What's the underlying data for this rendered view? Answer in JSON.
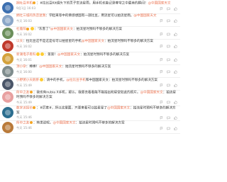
{
  "comments": [
    {
      "user": "拥吐豆羊机",
      "verified": true,
      "emojis": 0,
      "text_before_mention": "：#拉比豆Kit镜头下的页子世流星雨，用手机也能记录尊穹之中最美的瞬间！",
      "mention": "@中国国家天文",
      "text_after_mention": "",
      "time": "9月1日 16:03",
      "avatar_color": "#3c6fb0"
    },
    {
      "user": "拥吐三城的热恋迷我",
      "verified": false,
      "emojis": 0,
      "text_before_mention": "：学起来等中的佛感想国有一部比豆，用流星可以拍流星雨。",
      "mention": "@中国国家天文",
      "text_after_mention": "",
      "time": "今天 16:03",
      "avatar_color": "#8aa6c8"
    },
    {
      "user": "杜着阳",
      "verified": true,
      "emojis": 1,
      "text_before_mention": "：\"灰客了\"",
      "mention": "@中国国家天文",
      "text_after_mention": "：拍流星时预吗不够多的解决方案",
      "time": "今天 16:02",
      "avatar_color": "#6b8e5a"
    },
    {
      "user": "以天",
      "verified": false,
      "emojis": 0,
      "text_before_mention": "：拉比豆这不是这是号可以拍星星的手机",
      "mention": "@中国国家天文",
      "text_after_mention": "：拍流星时预吗不够多的解决方案",
      "time": "今天 16:02",
      "avatar_color": "#c0392b"
    },
    {
      "user": "新潮电子看科",
      "verified": false,
      "emojis": 2,
      "text_before_mention": "：第第！",
      "mention": "@中国国家天文",
      "text_after_mention": "：拍流星时预吗不够多的解决方案",
      "time": "今天 16:01",
      "avatar_color": "#d4a23c"
    },
    {
      "user": "顶小杂",
      "verified": false,
      "emojis": 0,
      "text_before_mention": "：棒棒！",
      "mention": "@中国国家天文",
      "text_after_mention": "：拍流星时预吗不够多的解决方案",
      "time": "今天 16:00",
      "avatar_color": "#7f8c8d"
    },
    {
      "user": "小野粥小天鹅肝",
      "verified": false,
      "emojis": 1,
      "text_before_mention": "：请中的手机，",
      "mention": "@拉比豆手机",
      "text_after_mention": "和中国国家天文：拍流星时预吗不够多的解决方案",
      "time": "今天 15:49",
      "avatar_color": "#4a5568"
    },
    {
      "user": "所中之友",
      "verified": true,
      "emojis": 0,
      "text_before_mention": "：我也有nubia X手机，那么，我要去看看能不能拍出和星空如此的照片。",
      "mention": "@中国国家天文",
      "text_after_mention": "：拍流星时预吗不够多的解决方案",
      "time": "今天 15:49",
      "avatar_color": "#e8a0a0"
    },
    {
      "user": "数字派探长",
      "verified": true,
      "emojis": 0,
      "text_before_mention": "：#厉客#，所以这里面，只要来看可以拍星星了",
      "mention": "@中国国家天文",
      "text_after_mention": "：拍流星时预吗不够多的解决方案",
      "time": "今天 15:46",
      "avatar_color": "#2c6e8f"
    },
    {
      "user": "所中之友",
      "verified": true,
      "emojis": 0,
      "text_before_mention": "：转发说呢。",
      "mention": "@中国国家天文",
      "text_after_mention": "：拍流星时预吗不够多的解决方案",
      "time": "今天 15:46",
      "avatar_color": "#b97a3a"
    }
  ],
  "actions": {
    "report_label": "",
    "reply_label": "",
    "like_label": ""
  }
}
